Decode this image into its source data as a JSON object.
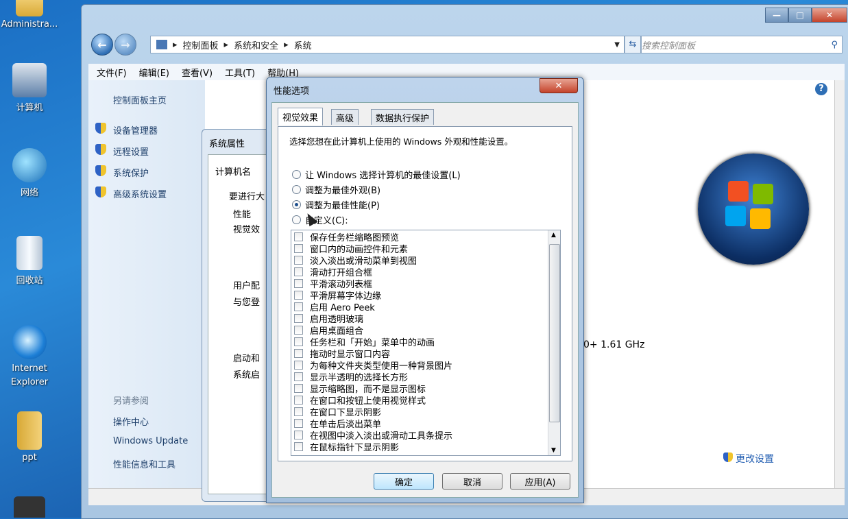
{
  "desktop": {
    "icons": [
      {
        "label": "Administra..."
      },
      {
        "label": "计算机"
      },
      {
        "label": "网络"
      },
      {
        "label": "回收站"
      },
      {
        "label": "Internet Explorer"
      },
      {
        "label": "ppt"
      }
    ]
  },
  "explorer": {
    "window_controls": {
      "minimize": "—",
      "maximize": "□",
      "close": "✕"
    },
    "breadcrumb": [
      "控制面板",
      "系统和安全",
      "系统"
    ],
    "search_placeholder": "搜索控制面板",
    "menu": [
      "文件(F)",
      "编辑(E)",
      "查看(V)",
      "工具(T)",
      "帮助(H)"
    ],
    "left_pane": {
      "home": "控制面板主页",
      "links": [
        "设备管理器",
        "远程设置",
        "系统保护",
        "高级系统设置"
      ],
      "see_also_title": "另请参阅",
      "see_also": [
        "操作中心",
        "Windows Update",
        "性能信息和工具"
      ]
    },
    "content": {
      "processor_speed": "0+ 1.61 GHz",
      "change_settings": "更改设置"
    }
  },
  "system_properties": {
    "title": "系统属性",
    "tab": "计算机名",
    "text1": "要进行大",
    "group1": "性能",
    "group1_text": "视觉效",
    "group2": "用户配",
    "group2_text": "与您登",
    "group3": "启动和",
    "group3_text": "系统启"
  },
  "performance_options": {
    "title": "性能选项",
    "close": "✕",
    "tabs": [
      "视觉效果",
      "高级",
      "数据执行保护"
    ],
    "description": "选择您想在此计算机上使用的 Windows 外观和性能设置。",
    "radios": [
      {
        "label": "让 Windows 选择计算机的最佳设置(L)",
        "checked": false
      },
      {
        "label": "调整为最佳外观(B)",
        "checked": false
      },
      {
        "label": "调整为最佳性能(P)",
        "checked": true
      },
      {
        "label": "自定义(C):",
        "checked": false
      }
    ],
    "effects": [
      "保存任务栏缩略图预览",
      "窗口内的动画控件和元素",
      "淡入淡出或滑动菜单到视图",
      "滑动打开组合框",
      "平滑滚动列表框",
      "平滑屏幕字体边缘",
      "启用 Aero Peek",
      "启用透明玻璃",
      "启用桌面组合",
      "任务栏和「开始」菜单中的动画",
      "拖动时显示窗口内容",
      "为每种文件夹类型使用一种背景图片",
      "显示半透明的选择长方形",
      "显示缩略图，而不是显示图标",
      "在窗口和按钮上使用视觉样式",
      "在窗口下显示阴影",
      "在单击后淡出菜单",
      "在视图中淡入淡出或滑动工具条提示",
      "在鼠标指针下显示阴影"
    ],
    "buttons": {
      "ok": "确定",
      "cancel": "取消",
      "apply": "应用(A)"
    }
  }
}
